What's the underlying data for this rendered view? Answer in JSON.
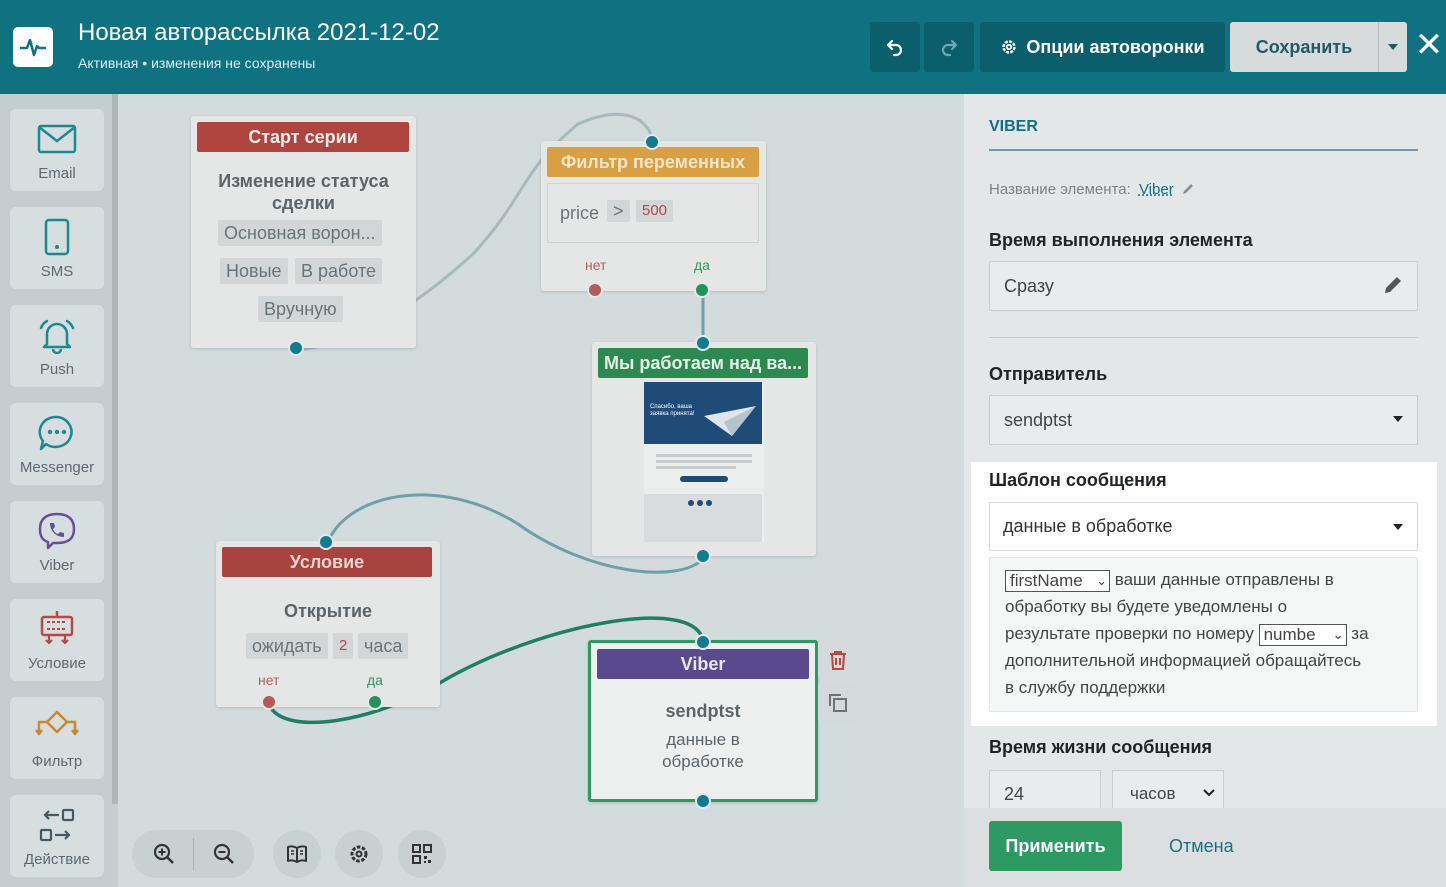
{
  "header": {
    "title": "Новая авторассылка 2021-12-02",
    "status": "Активная",
    "status_bullet": "•",
    "status_note": "изменения не сохранены",
    "options_label": "Опции автоворонки",
    "save_label": "Сохранить",
    "close_glyph": "✕"
  },
  "sidebar": {
    "items": [
      {
        "label": "Email",
        "icon": "envelope-icon"
      },
      {
        "label": "SMS",
        "icon": "phone-icon"
      },
      {
        "label": "Push",
        "icon": "bell-icon"
      },
      {
        "label": "Messenger",
        "icon": "chat-icon"
      },
      {
        "label": "Viber",
        "icon": "viber-icon"
      },
      {
        "label": "Условие",
        "icon": "condition-icon"
      },
      {
        "label": "Фильтр",
        "icon": "filter-icon"
      },
      {
        "label": "Действие",
        "icon": "action-icon"
      }
    ]
  },
  "canvas": {
    "start": {
      "header": "Старт серии",
      "title": "Изменение статуса сделки",
      "pipeline": "Основная ворон...",
      "stage_from": "Новые",
      "stage_to": "В работе",
      "mode": "Вручную"
    },
    "filter": {
      "header": "Фильтр переменных",
      "var": "price",
      "op": ">",
      "val": "500",
      "no": "нет",
      "yes": "да"
    },
    "email": {
      "header": "Мы работаем над ва...",
      "preview_text": "Спасибо, ваша заявка принята!"
    },
    "condition": {
      "header": "Условие",
      "title": "Открытие",
      "wait": "ожидать",
      "amount": "2",
      "unit": "часа",
      "no": "нет",
      "yes": "да"
    },
    "viber": {
      "header": "Viber",
      "sender": "sendptst",
      "template": "данные в обработке"
    }
  },
  "panel": {
    "title": "VIBER",
    "name_label": "Название элемента:",
    "name_value": "Viber",
    "time_label": "Время выполнения элемента",
    "time_value": "Сразу",
    "sender_label": "Отправитель",
    "sender_value": "sendptst",
    "template_label": "Шаблон сообщения",
    "template_value": "данные в обработке",
    "message": {
      "var1": "firstName",
      "text1": "ваши данные отправлены в",
      "text2": "обработку вы будете уведомлены о",
      "text3a": "результате проверки по номеру",
      "var2": "numbe",
      "text3b": "за",
      "text4": "дополнительной информацией обращайтесь",
      "text5": "в службу поддержки"
    },
    "ttl_label": "Время жизни сообщения",
    "ttl_value": "24",
    "ttl_unit": "часов",
    "apply_label": "Применить",
    "cancel_label": "Отмена"
  },
  "colors": {
    "header_bg": "#0f7281",
    "start_header": "#b0453f",
    "filter_header": "#d9a043",
    "email_header": "#2c8a50",
    "condition_header": "#a8443d",
    "viber_header": "#5a4a8d",
    "apply": "#2c9a62"
  }
}
